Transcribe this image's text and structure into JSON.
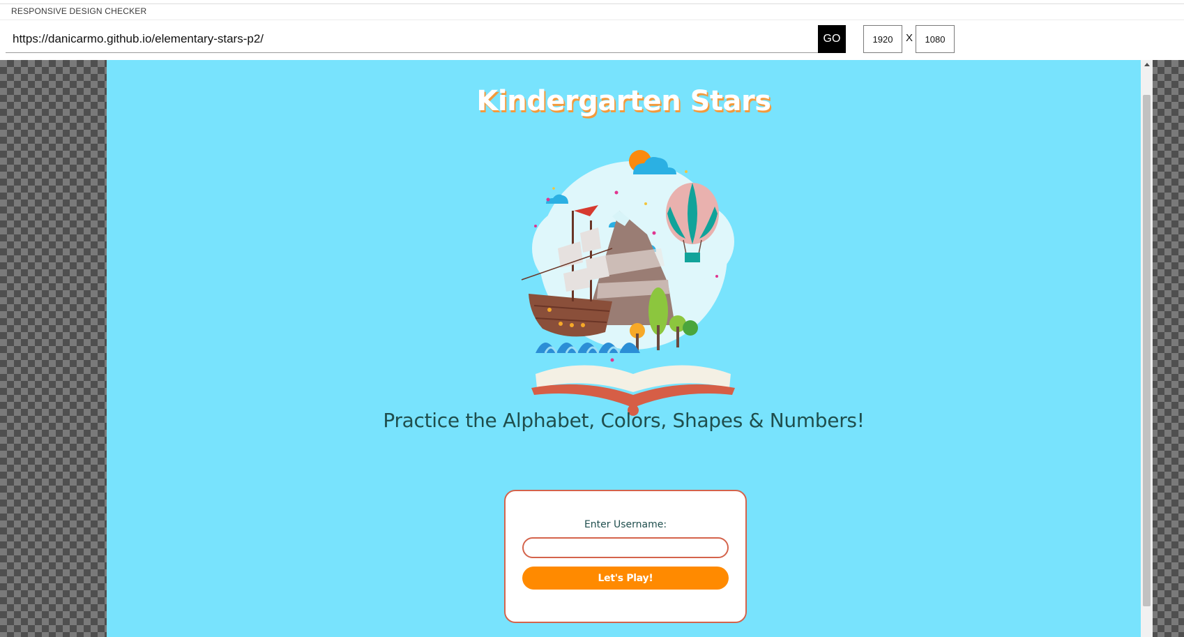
{
  "tool": {
    "title": "RESPONSIVE DESIGN CHECKER",
    "url": "https://danicarmo.github.io/elementary-stars-p2/",
    "go_label": "GO",
    "width": "1920",
    "height": "1080",
    "separator": "X"
  },
  "site": {
    "title": "Kindergarten Stars",
    "tagline": "Practice the Alphabet, Colors, Shapes & Numbers!",
    "hero_icon": "storybook-adventure-illustration",
    "username_label": "Enter Username:",
    "username_value": "",
    "play_label": "Let's Play!"
  },
  "colors": {
    "page_bg": "#78e3fd",
    "title_shadow": "#f39a3c",
    "text": "#1f4e4d",
    "accent": "#ff8a00",
    "card_border": "#d4634b"
  }
}
